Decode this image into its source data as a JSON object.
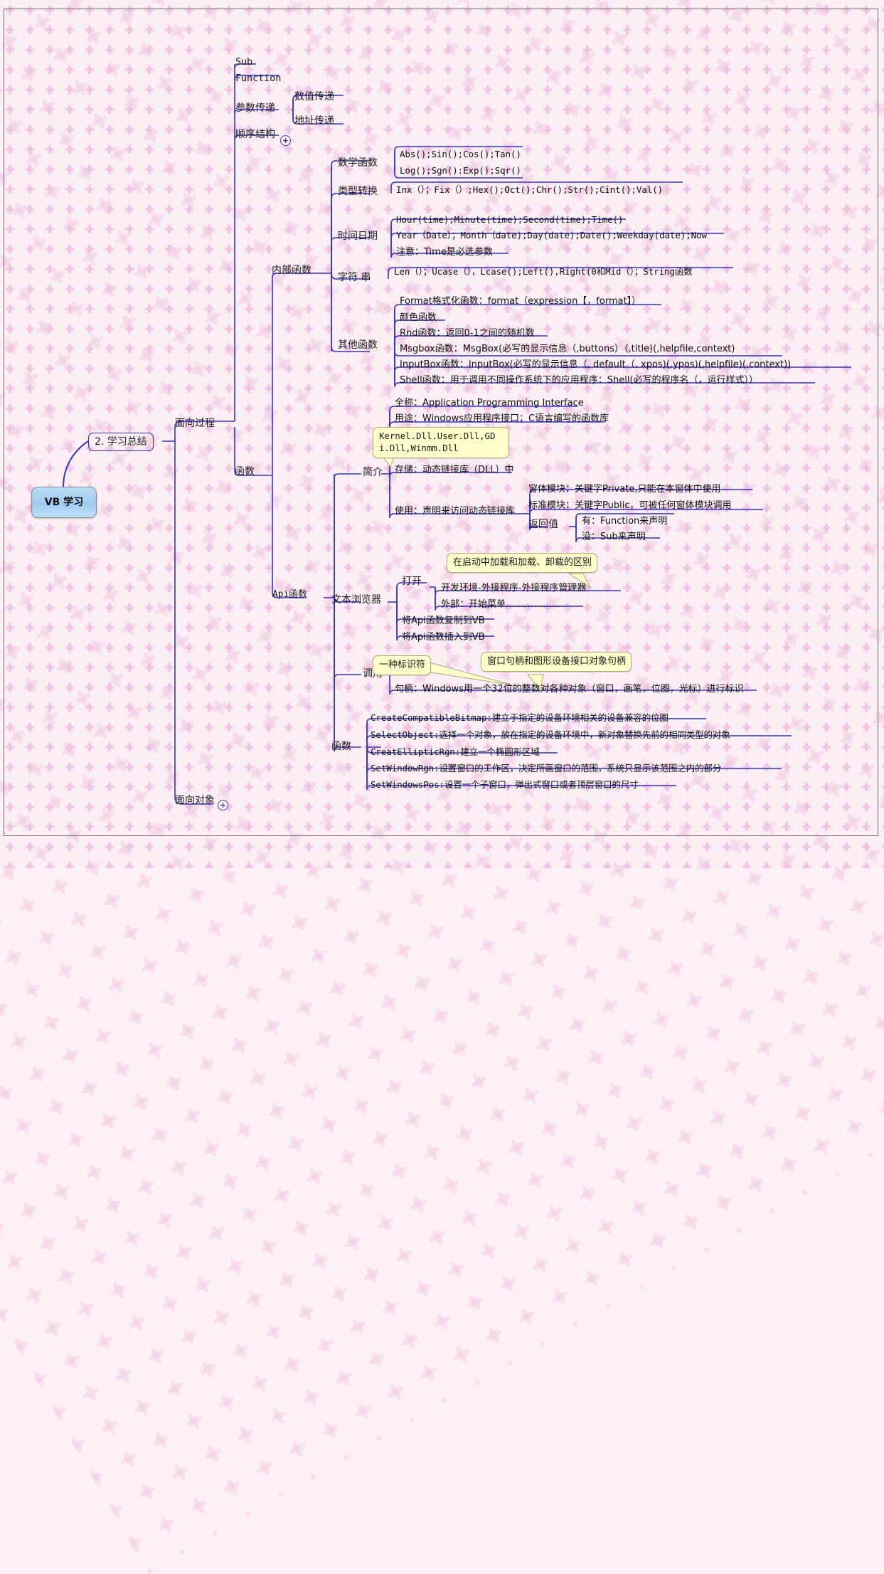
{
  "root": {
    "label": "VB 学习"
  },
  "chapter": {
    "label": "2. 学习总结"
  },
  "branches": {
    "process": "面向过程",
    "object": "面向对象",
    "function": "函数",
    "api": "Api函数"
  },
  "sequence": {
    "sub": "Sub",
    "functionKw": "Function",
    "paramPass": "参数传递",
    "byValue": "数值传递",
    "byRef": "地址传递",
    "seqStruct": "顺序结构"
  },
  "internal": {
    "title": "内部函数",
    "math": {
      "label": "数学函数",
      "items": [
        "Abs();Sin();Cos();Tan()",
        "Log();Sgn():Exp();Sqr()"
      ]
    },
    "convert": {
      "label": "类型转换",
      "items": [
        "Inx（）；Fix（）;Hex();Oct();Chr();Str();Cint();Val()"
      ]
    },
    "datetime": {
      "label": "时间日期",
      "items": [
        "Hour(time);Minute(time);Second(time);Time()",
        "Year（Date）；Month（date);Day(date);Date();Weekday(date);Now",
        "注意：Time是必选参数"
      ]
    },
    "string": {
      "label": "字符 串",
      "items": [
        "Len（）；Ucase（），Lcase();Left(),Right(0和Mid（）；String函数"
      ]
    },
    "other": {
      "label": "其他函数",
      "items": [
        "Format格式化函数：format（expression【，format】）",
        "颜色函数",
        "Rnd函数：返回0-1之间的随机数",
        "Msgbox函数：MsgBox(必写的显示信息（,buttons）（,title)(,helpfile,context)",
        "InputBox函数：InputBox(必写的显示信息（, default（, xpos)(,ypos)(,helpfile)(,context))",
        "Shell函数：用于调用不同操作系统下的应用程序：Shell(必写的程序名（，运行样式））"
      ]
    }
  },
  "api": {
    "intro": {
      "label": "简介",
      "items": [
        "全称：Application Programming Interface",
        "用途：Windows应用程序接口；C语言编写的函数库",
        "存储：动态链接库（DLL）中",
        "使用：声明来访问动态链接库"
      ],
      "note": "Kernel.Dll.User.Dll,GD\ni.Dll,Winmm.Dll",
      "usage": {
        "formModule": "窗体模块：关键字Private,只能在本窗体中使用",
        "stdModule": "标准模块：关键字Public，可被任何窗体模块调用",
        "returnLabel": "返回值",
        "hasReturn": "有：Function来声明",
        "noReturn": "没：Sub来声明"
      }
    },
    "browser": {
      "label": "文本浏览器",
      "open": "打开",
      "openItems": [
        "开发环境-外接程序-外接程序管理器",
        "外部：开始菜单………………"
      ],
      "items": [
        "将Api函数复制到VB",
        "将Api函数插入到VB"
      ],
      "note": "在启动中加载和加载、卸载的区别"
    },
    "call": {
      "label": "调用",
      "note1": "一种标识符",
      "note2": "窗口句柄和图形设备接口对象句柄",
      "item": "句柄：Windows用一个32位的整数对各种对象（窗口，画笔，位图，光标）进行标识"
    },
    "functions": {
      "label": "函数",
      "items": [
        "CreateCompatibleBitmap:建立于指定的设备环境相关的设备兼容的位图",
        "SelectObject:选择一个对象，放在指定的设备环境中，新对象替换先前的相同类型的对象",
        "CreatEllipticRgn:建立一个椭圆形区域",
        "SetWindowRgn:设置窗口的工作区，决定所画窗口的范围，系统只显示该范围之内的部分",
        "SetWindowsPos:设置一个子窗口，弹出式窗口或者顶层窗口的尺寸"
      ]
    }
  },
  "icons": {
    "expand": "+"
  },
  "colors": {
    "wire": "#3333cc",
    "root_fill": "#a9d3f0",
    "note_fill": "#ffffcc",
    "note_border": "#a9a97a",
    "background": "#fbeef5"
  }
}
